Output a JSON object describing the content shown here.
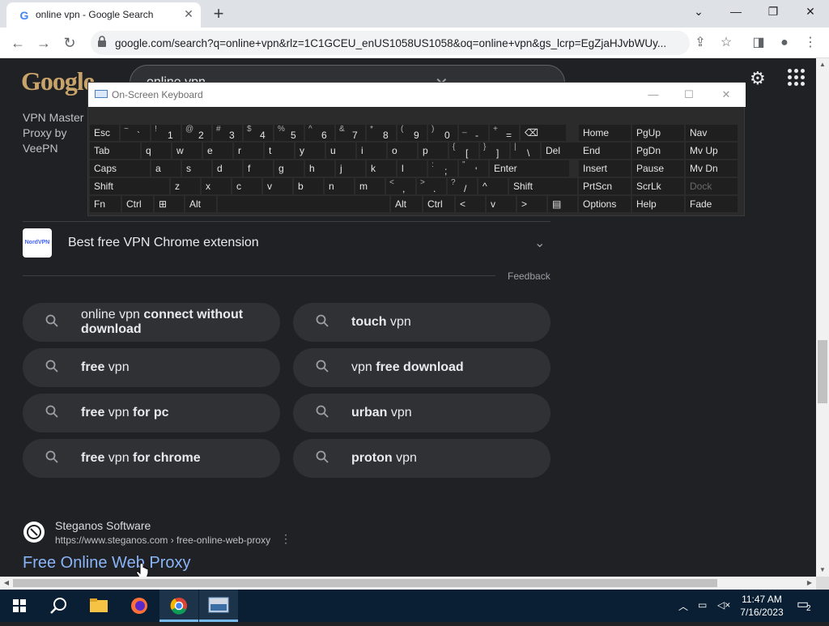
{
  "tab": {
    "title": "online vpn - Google Search",
    "favicon": "G"
  },
  "toolbar": {
    "url": "google.com/search?q=online+vpn&rlz=1C1GCEU_enUS1058US1058&oq=online+vpn&gs_lcrp=EgZjaHJvbWUy..."
  },
  "search": {
    "query": "online vpn",
    "logo": "Google"
  },
  "left_result": {
    "text": "VPN Master Proxy by VeePN"
  },
  "faq": {
    "logo_text": "NordVPN",
    "question": "Best free VPN Chrome extension"
  },
  "feedback": "Feedback",
  "related": [
    {
      "pre": "online vpn ",
      "bold": "connect without download",
      "post": ""
    },
    {
      "pre": "",
      "bold": "touch",
      "post": " vpn"
    },
    {
      "pre": "",
      "bold": "free",
      "post": " vpn"
    },
    {
      "pre": "vpn ",
      "bold": "free download",
      "post": ""
    },
    {
      "pre": "",
      "bold": "free",
      "post": " vpn ",
      "bold2": "for pc"
    },
    {
      "pre": "",
      "bold": "urban",
      "post": " vpn"
    },
    {
      "pre": "",
      "bold": "free",
      "post": " vpn ",
      "bold2": "for chrome"
    },
    {
      "pre": "",
      "bold": "proton",
      "post": " vpn"
    }
  ],
  "result": {
    "site_name": "Steganos Software",
    "url": "https://www.steganos.com › free-online-web-proxy",
    "title": "Free Online Web Proxy"
  },
  "osk": {
    "title": "On-Screen Keyboard",
    "rows": [
      [
        {
          "l": "Esc"
        },
        {
          "s": "~",
          "m": "`"
        },
        {
          "s": "!",
          "m": "1"
        },
        {
          "s": "@",
          "m": "2"
        },
        {
          "s": "#",
          "m": "3"
        },
        {
          "s": "$",
          "m": "4"
        },
        {
          "s": "%",
          "m": "5"
        },
        {
          "s": "^",
          "m": "6"
        },
        {
          "s": "&",
          "m": "7"
        },
        {
          "s": "*",
          "m": "8"
        },
        {
          "s": "(",
          "m": "9"
        },
        {
          "s": ")",
          "m": "0"
        },
        {
          "s": "_",
          "m": "-"
        },
        {
          "s": "+",
          "m": "="
        },
        {
          "l": "⌫"
        },
        {
          "l": "Home"
        },
        {
          "l": "PgUp"
        },
        {
          "l": "Nav"
        }
      ],
      [
        {
          "l": "Tab"
        },
        {
          "l": "q"
        },
        {
          "l": "w"
        },
        {
          "l": "e"
        },
        {
          "l": "r"
        },
        {
          "l": "t"
        },
        {
          "l": "y"
        },
        {
          "l": "u"
        },
        {
          "l": "i"
        },
        {
          "l": "o"
        },
        {
          "l": "p"
        },
        {
          "s": "{",
          "m": "["
        },
        {
          "s": "}",
          "m": "]"
        },
        {
          "s": "|",
          "m": "\\"
        },
        {
          "l": "Del"
        },
        {
          "l": "End"
        },
        {
          "l": "PgDn"
        },
        {
          "l": "Mv Up"
        }
      ],
      [
        {
          "l": "Caps"
        },
        {
          "l": "a"
        },
        {
          "l": "s"
        },
        {
          "l": "d"
        },
        {
          "l": "f"
        },
        {
          "l": "g"
        },
        {
          "l": "h"
        },
        {
          "l": "j"
        },
        {
          "l": "k"
        },
        {
          "l": "l"
        },
        {
          "s": ":",
          "m": ";"
        },
        {
          "s": "\"",
          "m": "'"
        },
        {
          "l": "Enter"
        },
        {
          "l": "Insert"
        },
        {
          "l": "Pause"
        },
        {
          "l": "Mv Dn"
        }
      ],
      [
        {
          "l": "Shift"
        },
        {
          "l": "z"
        },
        {
          "l": "x"
        },
        {
          "l": "c"
        },
        {
          "l": "v"
        },
        {
          "l": "b"
        },
        {
          "l": "n"
        },
        {
          "l": "m"
        },
        {
          "s": "<",
          "m": ","
        },
        {
          "s": ">",
          "m": "."
        },
        {
          "s": "?",
          "m": "/"
        },
        {
          "l": "^"
        },
        {
          "l": "Shift"
        },
        {
          "l": "PrtScn"
        },
        {
          "l": "ScrLk"
        },
        {
          "l": "Dock",
          "dim": true
        }
      ],
      [
        {
          "l": "Fn"
        },
        {
          "l": "Ctrl"
        },
        {
          "l": "⊞"
        },
        {
          "l": "Alt"
        },
        {
          "l": ""
        },
        {
          "l": "Alt"
        },
        {
          "l": "Ctrl"
        },
        {
          "l": "<"
        },
        {
          "l": "v"
        },
        {
          "l": ">"
        },
        {
          "l": "▤"
        },
        {
          "l": "Options"
        },
        {
          "l": "Help"
        },
        {
          "l": "Fade"
        }
      ]
    ]
  },
  "taskbar": {
    "time": "11:47 AM",
    "date": "7/16/2023",
    "notifications": "2"
  },
  "colors": {
    "page_bg": "#202124",
    "chip_bg": "#303134",
    "link": "#8ab4f8",
    "osk_key": "#1f1f1f"
  }
}
